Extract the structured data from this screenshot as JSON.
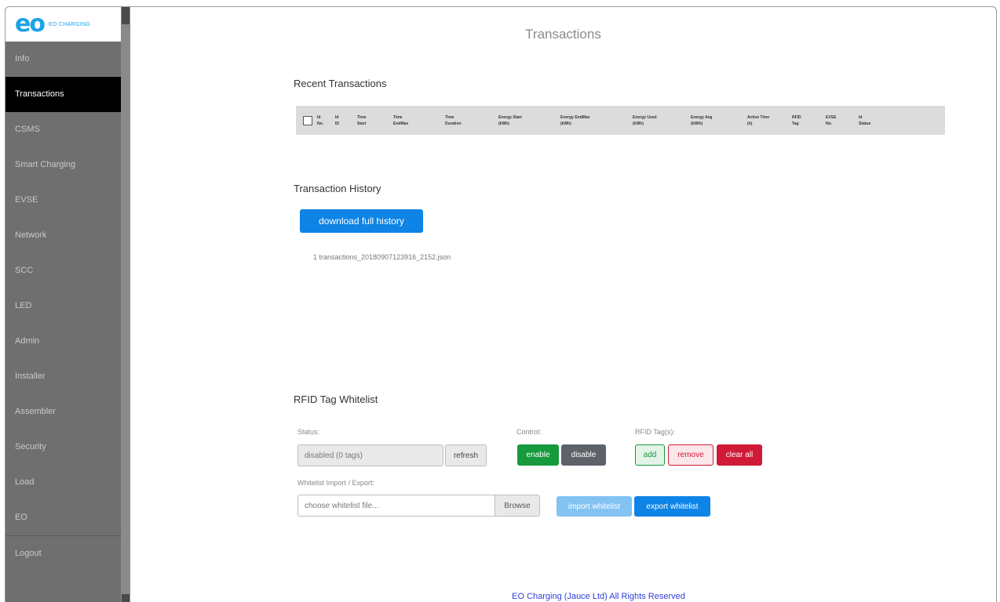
{
  "logo": {
    "mark": "eo",
    "text": "EO CHARGING"
  },
  "nav": [
    "Info",
    "Transactions",
    "CSMS",
    "Smart Charging",
    "EVSE",
    "Network",
    "SCC",
    "LED",
    "Admin",
    "Installer",
    "Assembler",
    "Security",
    "Load",
    "EO",
    "Logout"
  ],
  "page_title": "Transactions",
  "recent": {
    "title": "Recent Transactions",
    "headers": [
      [
        "Id",
        "No."
      ],
      [
        "Id",
        "ID"
      ],
      [
        "Time",
        "Start"
      ],
      [
        "Time",
        "EndMax"
      ],
      [
        "Time",
        "Duration"
      ],
      [
        "Energy Start",
        "(kWh)"
      ],
      [
        "Energy EndMax",
        "(kWh)"
      ],
      [
        "Energy Used",
        "(kWh)"
      ],
      [
        "Energy Avg",
        "(kW/h)"
      ],
      [
        "Active Time",
        "(h)"
      ],
      [
        "RFID",
        "Tag"
      ],
      [
        "EVSE",
        "No."
      ],
      [
        "Id",
        "Status"
      ]
    ]
  },
  "history": {
    "title": "Transaction History",
    "download_label": "download full history",
    "file": "1  transactions_20180907123916_2152.json"
  },
  "rfid": {
    "title": "RFID Tag Whitelist",
    "status_label": "Status:",
    "status_value": "disabled (0 tags)",
    "refresh_label": "refresh",
    "control_label": "Control:",
    "enable_label": "enable",
    "disable_label": "disable",
    "tags_label": "RFID Tag(s):",
    "add_label": "add",
    "remove_label": "remove",
    "clear_label": "clear all",
    "import_export_label": "Whitelist Import / Export:",
    "file_placeholder": "choose whitelist file...",
    "browse_label": "Browse",
    "import_label": "import whitelist",
    "export_label": "export whitelist"
  },
  "footer": "EO Charging (Jauce Ltd) All Rights Reserved",
  "colors": {
    "accent": "#0d84e6",
    "success": "#169a3d",
    "danger": "#d01a36",
    "secondary": "#5d6369",
    "sidebar": "#6f6f6f"
  }
}
